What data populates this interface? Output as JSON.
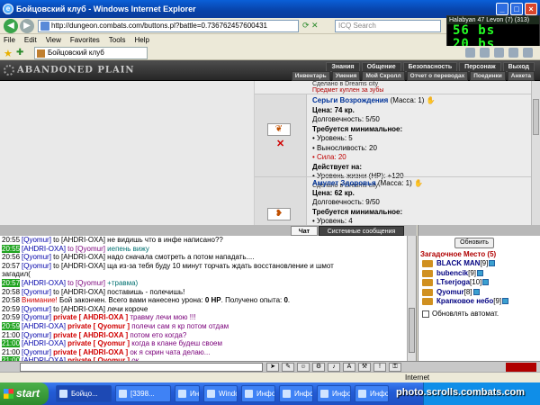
{
  "window": {
    "title": "Бойцовский клуб - Windows Internet Explorer"
  },
  "address": {
    "url": "http://dungeon.combats.com/buttons.pl?battle=0.736762457600431",
    "search_placeholder": "ICQ Search"
  },
  "overlay": {
    "title": "Halabyan 47 Levon (7) (313)",
    "digits1": "56 bs",
    "digits2": "20 bs"
  },
  "menubar": [
    "File",
    "Edit",
    "View",
    "Favorites",
    "Tools",
    "Help"
  ],
  "favbar": {
    "tab": "Бойцовский клуб"
  },
  "game": {
    "logo": "ABANDONED PLAIN",
    "menu_top": [
      "Знания",
      "Общение",
      "Безопасность",
      "Персонаж",
      "Выход"
    ],
    "menu_bottom": [
      "Инвентарь",
      "Умения",
      "Мой Скролл",
      "Отчет о переводах",
      "Поединки",
      "Анкета"
    ]
  },
  "shop": {
    "prev_made": "Сделано в Dreams city",
    "prev_bought": "Предмет куплен за зубы",
    "items": [
      {
        "name": "Серьги Возрождения",
        "mass": "(Масса: 1)",
        "price_label": "Цена:",
        "price": "74 кр.",
        "durability": "Долговечность: 5/50",
        "req_title": "Требуется минимальное:",
        "reqs": [
          "• Уровень: 5",
          "• Выносливость: 20"
        ],
        "req_fail": "• Сила: 20",
        "acts_title": "Действует на:",
        "acts": [
          "• Уровень жизни (HP): +120"
        ],
        "made": "Сделано в Dreams city"
      },
      {
        "name": "Амулет Здоровья",
        "mass": "(Масса: 1)",
        "price_label": "Цена:",
        "price": "62 кр.",
        "durability": "Долговечность: 9/50",
        "req_title": "Требуется минимальное:",
        "reqs": [
          "• Уровень: 4"
        ]
      }
    ]
  },
  "chat": {
    "tabs": [
      "Чат",
      "Системные сообщения"
    ],
    "lines": [
      {
        "t": "20:55",
        "hl": false,
        "parts": [
          {
            "c": "nick",
            "x": "[Qyomur]"
          },
          {
            "c": "",
            "x": " to [AHDRI-OXA] не видишь что в инфе написано??"
          }
        ]
      },
      {
        "t": "20:55",
        "hl": true,
        "parts": [
          {
            "c": "nick",
            "x": "[AHDRI-OXA]"
          },
          {
            "c": "nick-me",
            "x": " to [Qyomur] "
          },
          {
            "c": "teal",
            "x": "иепень вижу"
          }
        ]
      },
      {
        "t": "20:56",
        "hl": false,
        "parts": [
          {
            "c": "nick",
            "x": "[Qyomur]"
          },
          {
            "c": "",
            "x": " to [AHDRI-OXA] надо сначала смотреть а потом нападать...."
          }
        ]
      },
      {
        "t": "20:57",
        "hl": false,
        "parts": [
          {
            "c": "nick",
            "x": "[Qyomur]"
          },
          {
            "c": "",
            "x": " to [AHDRI-OXA] ща из-за тебя буду 10 минут торчать ждать восстановление и шмот"
          }
        ]
      },
      {
        "t": "",
        "hl": false,
        "parts": [
          {
            "c": "",
            "x": "загадил("
          }
        ]
      },
      {
        "t": "20:57",
        "hl": true,
        "parts": [
          {
            "c": "nick",
            "x": "[AHDRI-OXA]"
          },
          {
            "c": "nick-me",
            "x": " to [Qyomur] "
          },
          {
            "c": "teal",
            "x": "+травма)"
          }
        ]
      },
      {
        "t": "20:58",
        "hl": false,
        "parts": [
          {
            "c": "nick",
            "x": "[Qyomur]"
          },
          {
            "c": "",
            "x": " to [AHDRI-OXA] поставишь - полечишь!"
          }
        ]
      },
      {
        "t": "20:58",
        "hl": false,
        "parts": [
          {
            "c": "warn",
            "x": "Внимание!"
          },
          {
            "c": "",
            "x": " Бой закончен. Всего вами нанесено урона: "
          },
          {
            "c": "b",
            "x": "0 HP"
          },
          {
            "c": "",
            "x": ". Получено опыта: "
          },
          {
            "c": "b",
            "x": "0"
          },
          {
            "c": "",
            "x": "."
          }
        ]
      },
      {
        "t": "20:59",
        "hl": false,
        "parts": [
          {
            "c": "nick",
            "x": "[Qyomur]"
          },
          {
            "c": "",
            "x": " to [AHDRI-OXA] лечи короче"
          }
        ]
      },
      {
        "t": "20:59",
        "hl": false,
        "parts": [
          {
            "c": "nick",
            "x": "[Qyomur]"
          },
          {
            "c": "priv",
            "x": " private [ AHDRI-OXA ] "
          },
          {
            "c": "priv-msg",
            "x": "травму лечи мою !!!"
          }
        ]
      },
      {
        "t": "20:59",
        "hl": true,
        "parts": [
          {
            "c": "nick",
            "x": "[AHDRI-OXA]"
          },
          {
            "c": "priv",
            "x": " private [ Qyomur ] "
          },
          {
            "c": "priv-msg",
            "x": "полечи сам я кр потом отдам"
          }
        ]
      },
      {
        "t": "21:00",
        "hl": false,
        "parts": [
          {
            "c": "nick",
            "x": "[Qyomur]"
          },
          {
            "c": "priv",
            "x": " private [ AHDRI-OXA ] "
          },
          {
            "c": "priv-msg",
            "x": "потом ето когда?"
          }
        ]
      },
      {
        "t": "21:00",
        "hl": true,
        "parts": [
          {
            "c": "nick",
            "x": "[AHDRI-OXA]"
          },
          {
            "c": "priv",
            "x": " private [ Qyomur ] "
          },
          {
            "c": "priv-msg",
            "x": "когда в клане будеш своем"
          }
        ]
      },
      {
        "t": "21:00",
        "hl": false,
        "parts": [
          {
            "c": "nick",
            "x": "[Qyomur]"
          },
          {
            "c": "priv",
            "x": " private [ AHDRI-OXA ] "
          },
          {
            "c": "priv-msg",
            "x": "ок я скрин чата делаю..."
          }
        ]
      },
      {
        "t": "21:00",
        "hl": true,
        "parts": [
          {
            "c": "nick",
            "x": "[AHDRI-OXA]"
          },
          {
            "c": "priv",
            "x": " private [ Qyomur ] "
          },
          {
            "c": "priv-msg",
            "x": "ок"
          }
        ]
      }
    ]
  },
  "panel": {
    "refresh": "Обновить",
    "location": "Загадочное Место (5)",
    "players": [
      {
        "name": "BLACK MAN",
        "level": "[9]"
      },
      {
        "name": "bubencik",
        "level": "[9]"
      },
      {
        "name": "LTserjoga",
        "level": "[10]"
      },
      {
        "name": "Qyomur",
        "level": "[8]"
      },
      {
        "name": "Крапковое небо",
        "level": "[9]"
      }
    ],
    "auto_update": "Обновлять автомат."
  },
  "statusbar": {
    "zone": "Internet"
  },
  "taskbar": {
    "start": "start",
    "buttons": [
      "Бойцо...",
      "[3398...",
      "Инфо...",
      "Windo...",
      "Инфо...",
      "Инфо...",
      "Инфо...",
      "Инфо..."
    ]
  },
  "watermark": "photo.scrolls.combats.com"
}
